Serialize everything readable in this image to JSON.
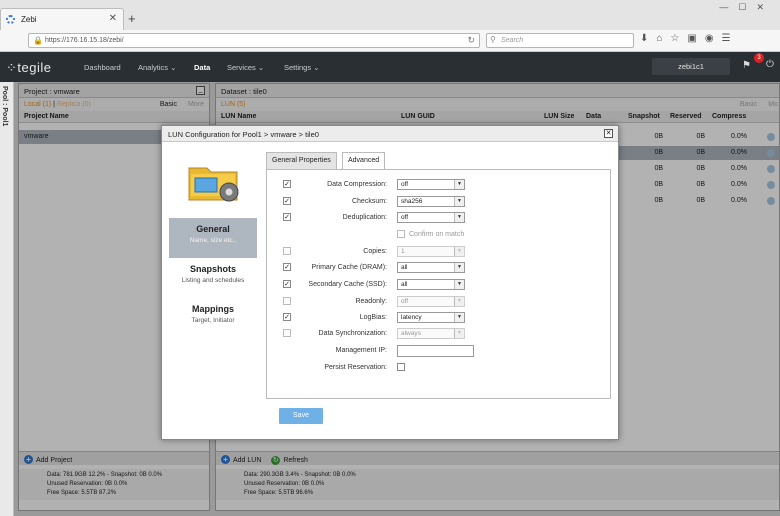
{
  "browser": {
    "tab_title": "Zebi",
    "new_tab": "+",
    "url": "https://176.16.15.18/zebi/",
    "search_placeholder": "Search"
  },
  "app": {
    "logo": "tegile",
    "nav": [
      "Dashboard",
      "Analytics",
      "Data",
      "Services",
      "Settings"
    ],
    "active_nav": "Data",
    "user": "zebi1c1",
    "notifications": "3"
  },
  "pool_label": "Pool : Pool1",
  "project_panel": {
    "title": "Project : vmware",
    "tab_local": "Local (1)",
    "tab_replica": "Replica (0)",
    "basic": "Basic",
    "more": "More",
    "col": "Project Name",
    "rows": [
      "vmware"
    ],
    "add": "Add Project",
    "stats": [
      "Data: 781.9GB 12.2% - Snapshot: 0B 0.0%",
      "Unused Reservation: 0B 0.0%",
      "Free Space: 5.5TB 87.2%"
    ]
  },
  "dataset_panel": {
    "title": "Dataset : tile0",
    "tab": "LUN (5)",
    "basic": "Basic",
    "more": "Mo",
    "cols": [
      "LUN Name",
      "LUN GUID",
      "LUN Size",
      "Data",
      "Snapshot",
      "Reserved",
      "Compress"
    ],
    "rows": [
      {
        "snapshot": "0B",
        "reserved": "0B",
        "compress": "0.0%"
      },
      {
        "snapshot": "0B",
        "reserved": "0B",
        "compress": "0.0%"
      },
      {
        "snapshot": "0B",
        "reserved": "0B",
        "compress": "0.0%"
      },
      {
        "snapshot": "0B",
        "reserved": "0B",
        "compress": "0.0%"
      },
      {
        "snapshot": "0B",
        "reserved": "0B",
        "compress": "0.0%"
      }
    ],
    "add": "Add LUN",
    "refresh": "Refresh",
    "stats": [
      "Data: 290.3GB 3.4% - Snapshot: 0B 0.0%",
      "Unused Reservation: 0B 0.0%",
      "Free Space: 5.5TB 96.6%"
    ]
  },
  "dialog": {
    "title": "LUN Configuration for Pool1 > vmware > tile0",
    "tabs": [
      "General Properties",
      "Advanced"
    ],
    "active_tab": "Advanced",
    "sidebar": [
      {
        "title": "General",
        "sub": "Name, size etc.,",
        "selected": true
      },
      {
        "title": "Snapshots",
        "sub": "Listing and schedules",
        "selected": false
      },
      {
        "title": "Mappings",
        "sub": "Target, Initiator",
        "selected": false
      }
    ],
    "fields": [
      {
        "label": "Data Compression:",
        "checked": true,
        "value": "off",
        "disabled": false
      },
      {
        "label": "Checksum:",
        "checked": true,
        "value": "sha256",
        "disabled": false
      },
      {
        "label": "Deduplication:",
        "checked": true,
        "value": "off",
        "disabled": false
      },
      {
        "label": "Copies:",
        "checked": false,
        "value": "1",
        "disabled": true
      },
      {
        "label": "Primary Cache (DRAM):",
        "checked": true,
        "value": "all",
        "disabled": false
      },
      {
        "label": "Secondary Cache (SSD):",
        "checked": true,
        "value": "all",
        "disabled": false
      },
      {
        "label": "Readonly:",
        "checked": false,
        "value": "off",
        "disabled": true
      },
      {
        "label": "LogBias:",
        "checked": true,
        "value": "latency",
        "disabled": false
      },
      {
        "label": "Data Synchronization:",
        "checked": false,
        "value": "always",
        "disabled": true
      }
    ],
    "confirm_on_match": "Confirm on match",
    "management_ip_label": "Management IP:",
    "management_ip_value": "",
    "persist_reservation_label": "Persist Reservation:",
    "save": "Save"
  }
}
